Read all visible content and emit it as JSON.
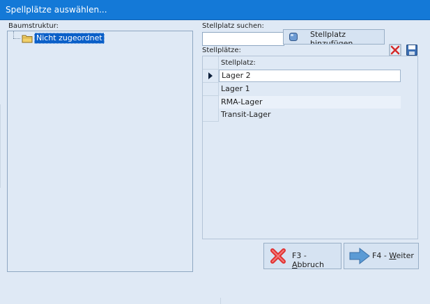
{
  "window": {
    "title": "Spellplätze auswählen..."
  },
  "tree": {
    "label": "Baumstruktur:",
    "nodes": [
      {
        "label": "Nicht zugeordnet",
        "icon": "folder-icon"
      }
    ]
  },
  "search": {
    "label": "Stellplatz suchen:",
    "value": ""
  },
  "add_button": {
    "label": "Stellplatz hinzufügen",
    "icon": "database-icon"
  },
  "toolbar": {
    "delete_icon": "delete-icon",
    "save_icon": "save-icon"
  },
  "grid": {
    "label": "Stellplätze:",
    "column": "Stellplatz:",
    "rows": [
      "Lager 2",
      "Lager 1",
      "RMA-Lager",
      "Transit-Lager"
    ],
    "selected_row": "Lager 2"
  },
  "buttons": {
    "cancel": {
      "prefix": "F3 - ",
      "accel": "A",
      "rest": "bbruch",
      "icon": "red-x-icon"
    },
    "next": {
      "prefix": "F4 - ",
      "accel": "W",
      "rest": "eiter",
      "icon": "right-arrow-icon"
    }
  },
  "colors": {
    "titlebar": "#1479d7",
    "background": "#dfe9f5",
    "selection": "#0a5fc8"
  }
}
